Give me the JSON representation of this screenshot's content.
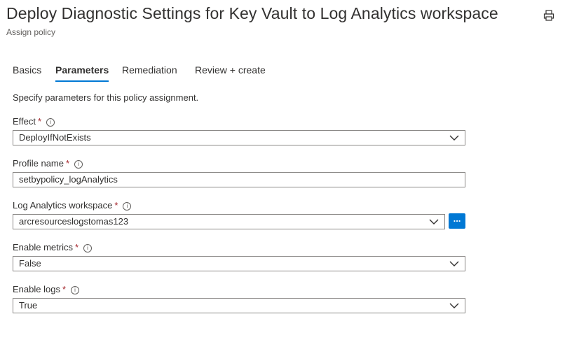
{
  "header": {
    "title": "Deploy Diagnostic Settings for Key Vault to Log Analytics workspace",
    "subtitle": "Assign policy"
  },
  "tabs": [
    {
      "label": "Basics",
      "active": false
    },
    {
      "label": "Parameters",
      "active": true
    },
    {
      "label": "Remediation",
      "active": false
    },
    {
      "label": "Review + create",
      "active": false
    }
  ],
  "intro": "Specify parameters for this policy assignment.",
  "fields": {
    "effect": {
      "label": "Effect",
      "required": "*",
      "value": "DeployIfNotExists"
    },
    "profile_name": {
      "label": "Profile name",
      "required": "*",
      "value": "setbypolicy_logAnalytics"
    },
    "workspace": {
      "label": "Log Analytics workspace",
      "required": "*",
      "value": "arcresourceslogstomas123",
      "browse_label": "..."
    },
    "enable_metrics": {
      "label": "Enable metrics",
      "required": "*",
      "value": "False"
    },
    "enable_logs": {
      "label": "Enable logs",
      "required": "*",
      "value": "True"
    }
  },
  "info_glyph": "i",
  "colors": {
    "accent": "#0078d4",
    "required": "#a4262c",
    "border": "#8a8886"
  },
  "icons": [
    "print-icon",
    "info-icon",
    "chevron-down-icon"
  ]
}
